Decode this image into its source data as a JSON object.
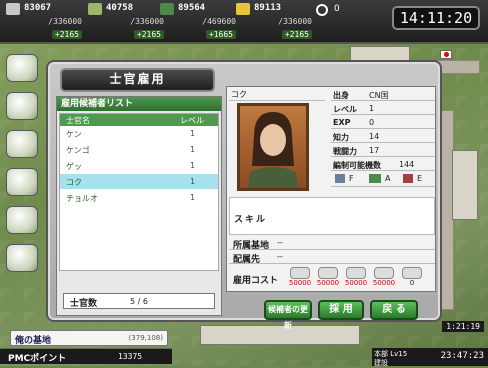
{
  "resources": [
    {
      "id": "fuel",
      "value": "83067",
      "max": "/336000",
      "inc": "+2165",
      "color": "#c8c8c8"
    },
    {
      "id": "ammo",
      "value": "40758",
      "max": "/336000",
      "inc": "+2165",
      "color": "#9ab86a"
    },
    {
      "id": "men",
      "value": "89564",
      "max": "/469600",
      "inc": "+1665",
      "color": "#4b8a4b"
    },
    {
      "id": "gold",
      "value": "89113",
      "max": "/336000",
      "inc": "+2165",
      "color": "#e8c53a"
    }
  ],
  "extra_counter": "0",
  "clock": "14:11:20",
  "dialog": {
    "title": "士官雇用",
    "candidates_header": "雇用候補者リスト",
    "col_name": "士官名",
    "col_level": "レベル",
    "candidates": [
      {
        "name": "ケン",
        "level": "1"
      },
      {
        "name": "ケンゴ",
        "level": "1"
      },
      {
        "name": "ゲッ",
        "level": "1"
      },
      {
        "name": "コク",
        "level": "1",
        "selected": true
      },
      {
        "name": "チョルオ",
        "level": "1"
      }
    ],
    "officer_count_label": "士官数",
    "officer_count_value": "5 / 6",
    "detail": {
      "name": "コク",
      "stats": [
        {
          "k": "出身",
          "v": "CN国"
        },
        {
          "k": "レベル",
          "v": "1"
        },
        {
          "k": "EXP",
          "v": "0"
        },
        {
          "k": "知力",
          "v": "14"
        },
        {
          "k": "戦闘力",
          "v": "17"
        },
        {
          "k": "編制可能機数",
          "v": "144"
        }
      ],
      "ranks": [
        {
          "icon": "rifle-icon",
          "grade": "F"
        },
        {
          "icon": "vehicle-icon",
          "grade": "A"
        },
        {
          "icon": "aircraft-icon",
          "grade": "E"
        }
      ],
      "skill_label": "スキル",
      "base_label": "所属基地",
      "base_value": "--",
      "assign_label": "配属先",
      "assign_value": "--",
      "cost_label": "雇用コスト",
      "costs": [
        {
          "icon": "fuel-icon",
          "value": "50000",
          "red": true
        },
        {
          "icon": "ammo-icon",
          "value": "50000",
          "red": true
        },
        {
          "icon": "men-icon",
          "value": "50000",
          "red": true
        },
        {
          "icon": "gold-icon",
          "value": "50000",
          "red": true
        },
        {
          "icon": "ring-icon",
          "value": "0",
          "red": false
        }
      ]
    },
    "buttons": {
      "refresh": "候補者の更新",
      "hire": "採 用",
      "back": "戻 る"
    }
  },
  "base": {
    "name": "俺の基地",
    "coords": "(379,108)"
  },
  "pmc": {
    "label": "PMCポイント",
    "value": "13375"
  },
  "status": {
    "line1": "本部 Lv15",
    "line2": "建設",
    "time": "23:47:23",
    "side_time": "1:21:19"
  }
}
